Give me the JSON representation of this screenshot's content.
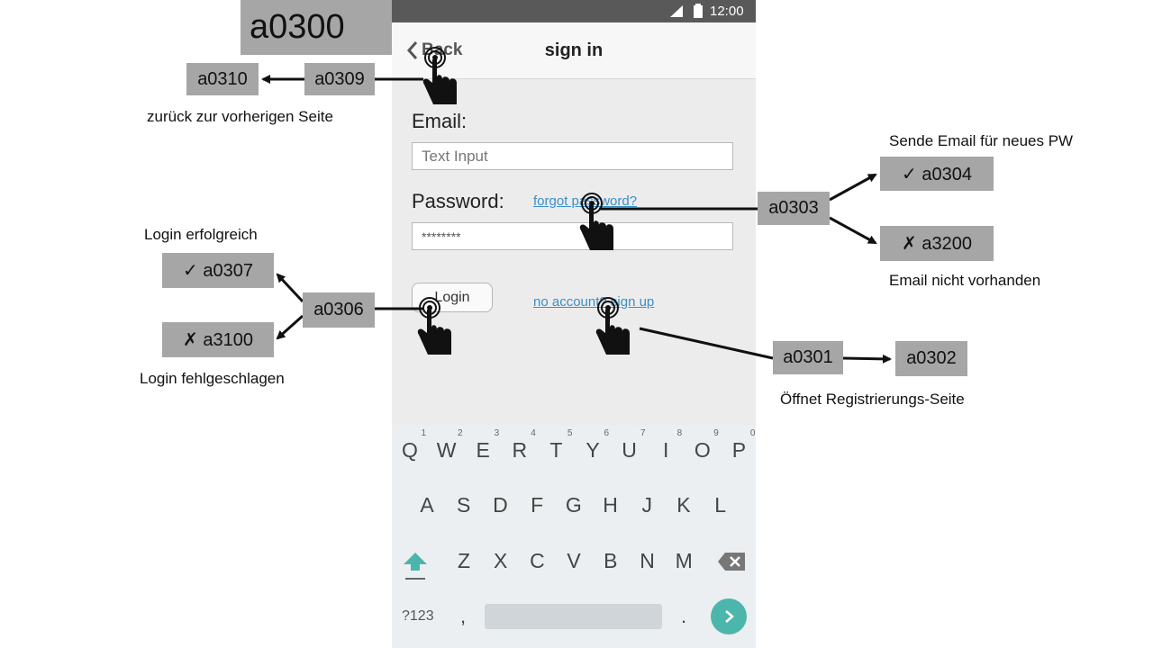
{
  "screen_id": "a0300",
  "statusbar": {
    "time": "12:00"
  },
  "appbar": {
    "back_label": "Back",
    "title": "sign in"
  },
  "form": {
    "email_label": "Email:",
    "email_placeholder": "Text Input",
    "password_label": "Password:",
    "password_value": "********",
    "forgot_link": "forgot password?",
    "login_button": "Login",
    "signup_link": "no account? sign up"
  },
  "keyboard": {
    "row1": [
      {
        "k": "Q",
        "n": "1"
      },
      {
        "k": "W",
        "n": "2"
      },
      {
        "k": "E",
        "n": "3"
      },
      {
        "k": "R",
        "n": "4"
      },
      {
        "k": "T",
        "n": "5"
      },
      {
        "k": "Y",
        "n": "6"
      },
      {
        "k": "U",
        "n": "7"
      },
      {
        "k": "I",
        "n": "8"
      },
      {
        "k": "O",
        "n": "9"
      },
      {
        "k": "P",
        "n": "0"
      }
    ],
    "row2": [
      "A",
      "S",
      "D",
      "F",
      "G",
      "H",
      "J",
      "K",
      "L"
    ],
    "row3": [
      "Z",
      "X",
      "C",
      "V",
      "B",
      "N",
      "M"
    ],
    "symbols_key": "?123",
    "comma_key": ",",
    "period_key": "."
  },
  "annotations": {
    "a0309": "a0309",
    "a0310": "a0310",
    "back_note": "zurück zur vorherigen Seite",
    "a0303": "a0303",
    "a0304": "✓  a0304",
    "a3200": "✗  a3200",
    "forgot_ok_note": "Sende Email für neues PW",
    "forgot_fail_note": "Email nicht vorhanden",
    "a0306": "a0306",
    "a0307": "✓  a0307",
    "a3100": "✗  a3100",
    "login_ok_note": "Login erfolgreich",
    "login_fail_note": "Login fehlgeschlagen",
    "a0301": "a0301",
    "a0302": "a0302",
    "signup_note": "Öffnet Registrierungs-Seite"
  },
  "colors": {
    "annotation_box": "#a6a6a6",
    "link": "#3a8fc8",
    "go_button": "#4db6ac",
    "shift": "#4db6ac"
  }
}
